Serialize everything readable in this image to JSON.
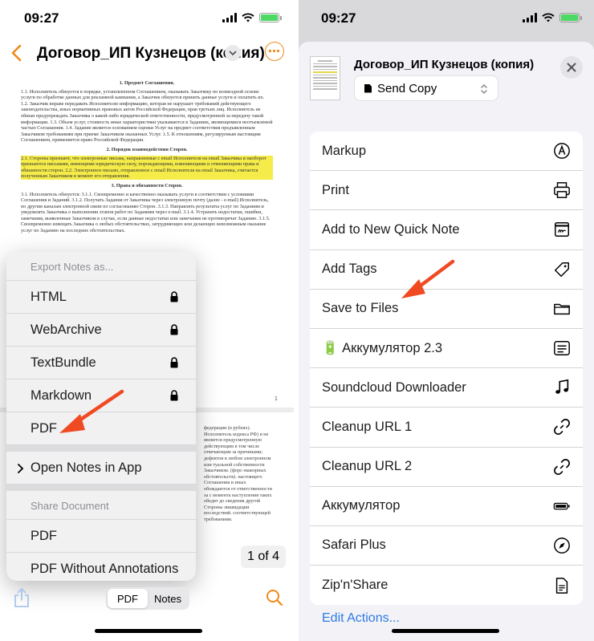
{
  "left": {
    "status": {
      "time": "09:27"
    },
    "nav": {
      "title": "Договор_ИП Кузнецов (копия)"
    },
    "document": {
      "section1_title": "1. Предмет Соглашения.",
      "section1_text": "1.1. Исполнитель обязуется в порядке, установленном Соглашением, оказывать Заказчику по возмездной основе услуги по обработке данных для рекламной кампании, а Заказчик обязуется принять данные услуги и оплатить их. 1.2. Заказчик вправе передавать Исполнителю информацию, которая не нарушает требований действующего законодательства, иных нормативных правовых актов Российской Федерации, прав третьих лиц. Исполнитель не обязан предупреждать Заказчика о какой-либо юридической ответственности, предусмотренной за передачу такой информации. 1.3. Объем услуг, стоимость иные характеристики указываются в Заданиях, являющимися неотъемлемой частью Соглашения. 1.4. Задание является основанием оценки Услуг на предмет соответствия предъявленным Заказчиком требованиям при приеме Заказчиком оказанных Услуг. 1.5. К отношениям, регулируемым настоящим Соглашением, применяется право Российской Федерации.",
      "section2_title": "2. Порядок взаимодействия Сторон.",
      "section2_text": "2.1. Стороны признают, что электронные письма, направленные с email Исполнителя на email Заказчика и наоборот признаются письмами, имеющими юридическую силу, порождающими, изменяющими и отменяющими права и обязанности сторон. 2.2. Электронное письмо, отправленное с email Исполнителя на email Заказчика, считается полученным Заказчиком в момент его отправления.",
      "section3_title": "3. Права и обязанности Сторон.",
      "section3_text": "3.1. Исполнитель обязуется: 3.1.1. Своевременно и качественно оказывать услуги в соответствии с условиями Соглашения и Заданий. 3.1.2. Получать Задания от Заказчика через электронную почту (далее - e-mail) Исполнитель, по другим каналам электронной связи по согласованию Сторон. 3.1.3. Направлять результаты услуг по Заданиям и уведомлять Заказчика о выполнении этапов работ по Заданиям через e-mail. 3.1.4. Устранять недостатки, ошибки, замечания, выявленные Заказчиком в случае, если данные недостатки или замечания не противоречат Заданию. 3.1.5. Своевременно извещать Заказчика о любых обстоятельствах, затрудняющих или делающих невозможным оказание услуг по Заданию на последних обстоятельствах.",
      "page_number": "1",
      "page2_text": "федерации (в рублях). Исполнитель кодекса РФ) и не является предусмотренную действующим в том числе отвечающим за причинами; дефектов в любом электронном или туальной собственности Заказчиком. (форс-мажорных обстоятельств). настоящего Соглашения и иных обождаются от ответственности за с момента наступления таких обедят до сведения другой Стороны ликвидации последствий. соответствующей требованиям."
    },
    "menu": {
      "export_header": "Export Notes as...",
      "export_items": [
        {
          "label": "HTML",
          "locked": true
        },
        {
          "label": "WebArchive",
          "locked": true
        },
        {
          "label": "TextBundle",
          "locked": true
        },
        {
          "label": "Markdown",
          "locked": true
        },
        {
          "label": "PDF",
          "locked": false
        }
      ],
      "open_in_app": "Open Notes in App",
      "share_header": "Share Document",
      "share_items": [
        "PDF",
        "PDF Without Annotations"
      ]
    },
    "page_indicator": "1 of 4",
    "toolbar": {
      "seg_pdf": "PDF",
      "seg_notes": "Notes"
    },
    "colors": {
      "accent": "#f08a1a",
      "highlight": "#f5ec4a"
    }
  },
  "right": {
    "status": {
      "time": "09:27"
    },
    "sheet": {
      "title": "Договор_ИП Кузнецов (копия)",
      "send_option": "Send Copy"
    },
    "actions": [
      {
        "label": "Markup",
        "icon": "markup-pen-icon"
      },
      {
        "label": "Print",
        "icon": "printer-icon"
      },
      {
        "label": "Add to New Quick Note",
        "icon": "quick-note-icon"
      },
      {
        "label": "Add Tags",
        "icon": "tag-icon"
      },
      {
        "label": "Save to Files",
        "icon": "folder-icon"
      },
      {
        "label": "🔋 Аккумулятор 2.3",
        "icon": "list-icon"
      },
      {
        "label": "Soundcloud Downloader",
        "icon": "music-note-icon"
      },
      {
        "label": "Cleanup URL 1",
        "icon": "link-icon"
      },
      {
        "label": "Cleanup URL 2",
        "icon": "link-icon"
      },
      {
        "label": "Аккумулятор",
        "icon": "battery-icon"
      },
      {
        "label": "Safari Plus",
        "icon": "compass-icon"
      },
      {
        "label": "Zip'n'Share",
        "icon": "document-icon"
      }
    ],
    "edit_actions": "Edit Actions...",
    "colors": {
      "link": "#2f7ae5",
      "arrow": "#f04a23"
    }
  }
}
